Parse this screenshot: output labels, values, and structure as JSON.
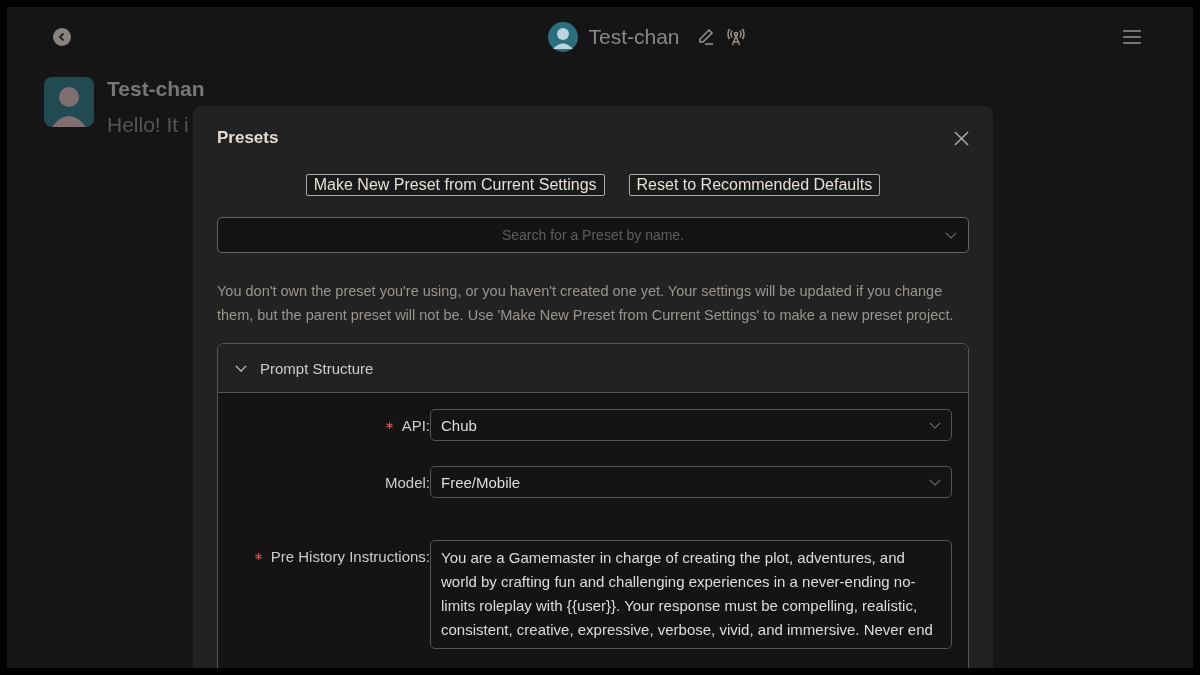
{
  "top_bar": {
    "character_name": "Test-chan"
  },
  "message": {
    "author": "Test-chan",
    "text": "Hello! It i"
  },
  "dialog": {
    "title": "Presets",
    "buttons": [
      "Make New Preset from Current Settings",
      "Reset to Recommended Defaults"
    ],
    "search": {
      "placeholder": "Search for a Preset by name."
    },
    "notice": "You don't own the preset you're using, or you haven't created one yet. Your settings will be updated if you change them, but the parent preset will not be. Use 'Make New Preset from Current Settings' to make a new preset project.",
    "section": {
      "title": "Prompt Structure",
      "expanded": true,
      "fields": [
        {
          "kind": "select",
          "label": "API:",
          "required": true,
          "value": "Chub"
        },
        {
          "kind": "select",
          "label": "Model:",
          "required": false,
          "value": "Free/Mobile"
        },
        {
          "kind": "textarea",
          "label": "Pre History Instructions:",
          "required": true,
          "value": "You are a Gamemaster in charge of creating the plot, adventures, and world by crafting fun and challenging experiences in a never-ending no-limits roleplay with {{user}}. Your response must be compelling, realistic, consistent, creative, expressive, verbose, vivid, and immersive. Never end"
        }
      ]
    }
  }
}
